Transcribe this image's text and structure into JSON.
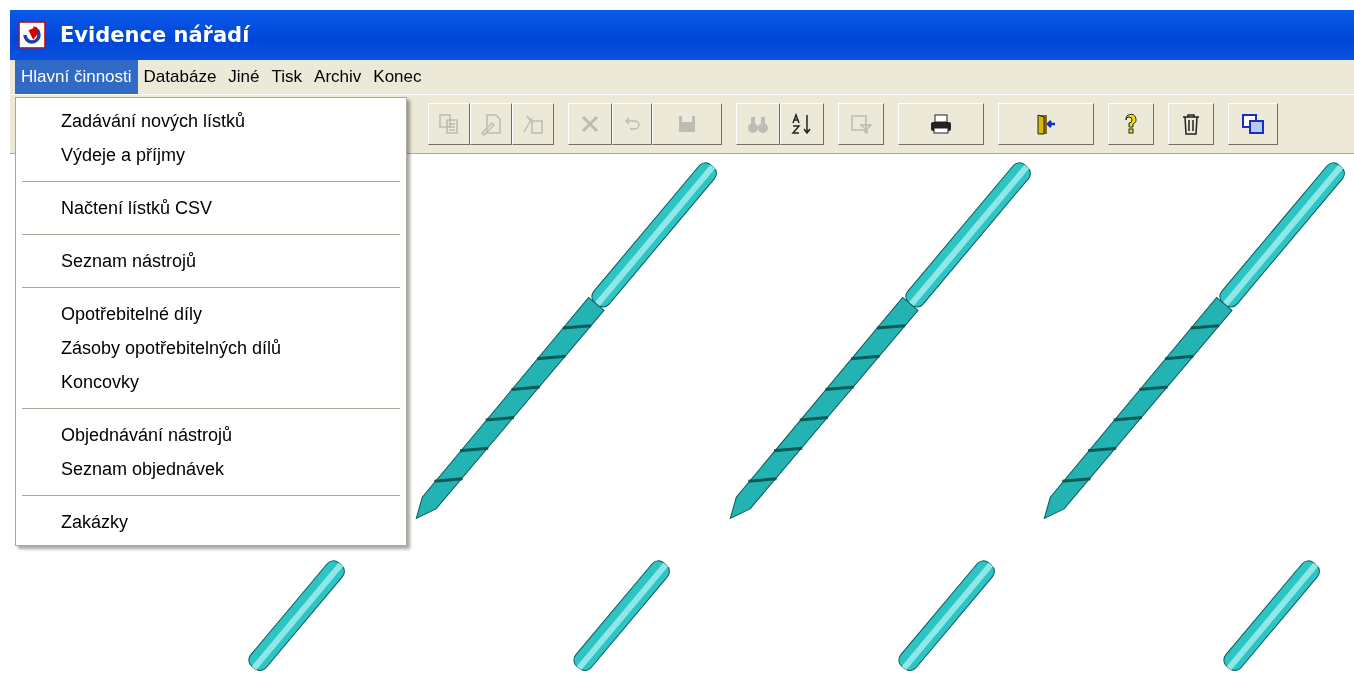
{
  "window": {
    "title": "Evidence nářadí"
  },
  "menu_bar": [
    {
      "label": "Hlavní činnosti",
      "selected": true
    },
    {
      "label": "Databáze",
      "selected": false
    },
    {
      "label": "Jiné",
      "selected": false
    },
    {
      "label": "Tisk",
      "selected": false
    },
    {
      "label": "Archiv",
      "selected": false
    },
    {
      "label": "Konec",
      "selected": false
    }
  ],
  "dropdown": {
    "groups": [
      [
        "Zadávání nových lístků",
        "Výdeje a příjmy"
      ],
      [
        "Načtení lístků CSV"
      ],
      [
        "Seznam nástrojů"
      ],
      [
        "Opotřebitelné díly",
        "Zásoby opotřebitelných dílů",
        "Koncovky"
      ],
      [
        "Objednávání nástrojů",
        "Seznam objednávek"
      ],
      [
        "Zakázky"
      ]
    ]
  },
  "toolbar": [
    [
      {
        "kind": "copy",
        "disabled": true
      },
      {
        "kind": "edit",
        "disabled": true
      },
      {
        "kind": "replace",
        "disabled": true
      }
    ],
    [
      {
        "kind": "delete",
        "disabled": true
      },
      {
        "kind": "undo",
        "disabled": true
      },
      {
        "kind": "save",
        "disabled": true
      }
    ],
    [
      {
        "kind": "find",
        "disabled": true
      },
      {
        "kind": "sort",
        "disabled": false
      }
    ],
    [
      {
        "kind": "filter",
        "disabled": true
      }
    ],
    [
      {
        "kind": "print",
        "disabled": false
      }
    ],
    [
      {
        "kind": "exit",
        "disabled": false
      }
    ],
    [
      {
        "kind": "help",
        "disabled": false
      }
    ],
    [
      {
        "kind": "trash",
        "disabled": false
      }
    ],
    [
      {
        "kind": "windows",
        "disabled": false
      }
    ]
  ]
}
